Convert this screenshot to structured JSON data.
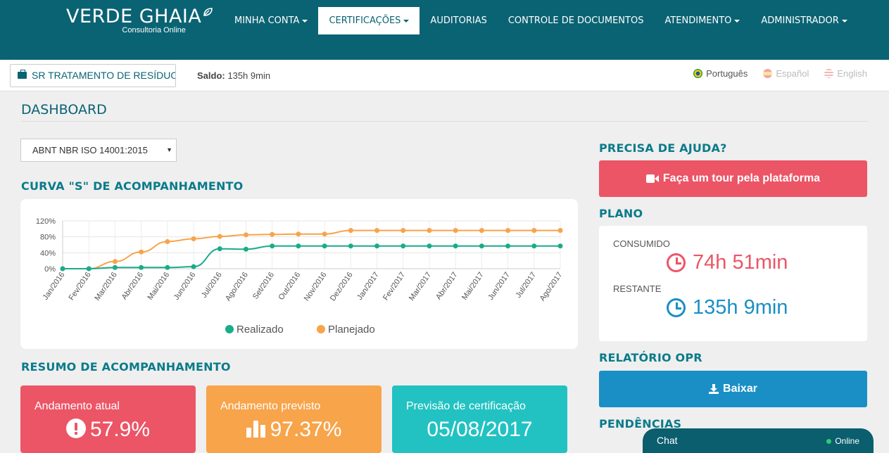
{
  "brand": {
    "name": "VERDE GHAIA",
    "tagline": "Consultoria Online"
  },
  "nav": {
    "items": [
      {
        "label": "MINHA CONTA",
        "dropdown": true,
        "active": false
      },
      {
        "label": "CERTIFICAÇÕES",
        "dropdown": true,
        "active": true
      },
      {
        "label": "AUDITORIAS",
        "dropdown": false,
        "active": false
      },
      {
        "label": "CONTROLE DE DOCUMENTOS",
        "dropdown": false,
        "active": false
      },
      {
        "label": "ATENDIMENTO",
        "dropdown": true,
        "active": false
      },
      {
        "label": "ADMINISTRADOR",
        "dropdown": true,
        "active": false
      }
    ]
  },
  "subbar": {
    "company": "SR TRATAMENTO DE RESÍDUOS",
    "saldo_label": "Saldo:",
    "saldo_value": "135h 9min",
    "languages": [
      {
        "label": "Português",
        "active": true
      },
      {
        "label": "Español",
        "active": false
      },
      {
        "label": "English",
        "active": false
      }
    ]
  },
  "dashboard": {
    "title": "DASHBOARD",
    "norm_select": "ABNT NBR ISO 14001:2015",
    "curve_title": "CURVA \"S\" DE ACOMPANHAMENTO",
    "summary_title": "RESUMO DE ACOMPANHAMENTO"
  },
  "chart_data": {
    "type": "line",
    "categories": [
      "Jan/2016",
      "Fev/2016",
      "Mar/2016",
      "Abr/2016",
      "Mai/2016",
      "Jun/2016",
      "Jul/2016",
      "Ago/2016",
      "Set/2016",
      "Out/2016",
      "Nov/2016",
      "Dez/2016",
      "Jan/2017",
      "Fev/2017",
      "Mar/2017",
      "Abr/2017",
      "Mai/2017",
      "Jun/2017",
      "Jul/2017",
      "Ago/2017"
    ],
    "yticks": [
      "0%",
      "40%",
      "80%",
      "120%"
    ],
    "ylim": [
      0,
      120
    ],
    "series": [
      {
        "name": "Realizado",
        "color": "#1aab8a",
        "values": [
          0,
          0,
          3,
          3,
          3,
          5,
          50,
          49,
          57,
          57,
          57,
          57,
          57,
          57,
          57,
          57,
          57,
          57,
          57,
          57
        ]
      },
      {
        "name": "Planejado",
        "color": "#f7a44b",
        "values": [
          0,
          0,
          18,
          42,
          68,
          75,
          81,
          85,
          86,
          87,
          87,
          96,
          96,
          96,
          96,
          96,
          96,
          96,
          96,
          96
        ]
      }
    ],
    "grid": true,
    "legend": "bottom"
  },
  "summary": {
    "current_label": "Andamento atual",
    "current_value": "57.9%",
    "planned_label": "Andamento previsto",
    "planned_value": "97.37%",
    "forecast_label": "Previsão de certificação",
    "forecast_value": "05/08/2017"
  },
  "help": {
    "title": "PRECISA DE AJUDA?",
    "tour_button": "Faça um tour pela plataforma"
  },
  "plan": {
    "title": "PLANO",
    "consumed_label": "CONSUMIDO",
    "consumed_value": "74h 51min",
    "remaining_label": "RESTANTE",
    "remaining_value": "135h 9min"
  },
  "report": {
    "title": "RELATÓRIO OPR",
    "download_button": "Baixar"
  },
  "pending": {
    "title": "PENDÊNCIAS"
  },
  "chat": {
    "title": "Chat",
    "status": "Online"
  },
  "colors": {
    "primary": "#0a6373",
    "red": "#ec5566",
    "orange": "#f7a44b",
    "teal": "#22c2c2",
    "blue": "#1a8fc5",
    "green": "#1aab8a"
  }
}
